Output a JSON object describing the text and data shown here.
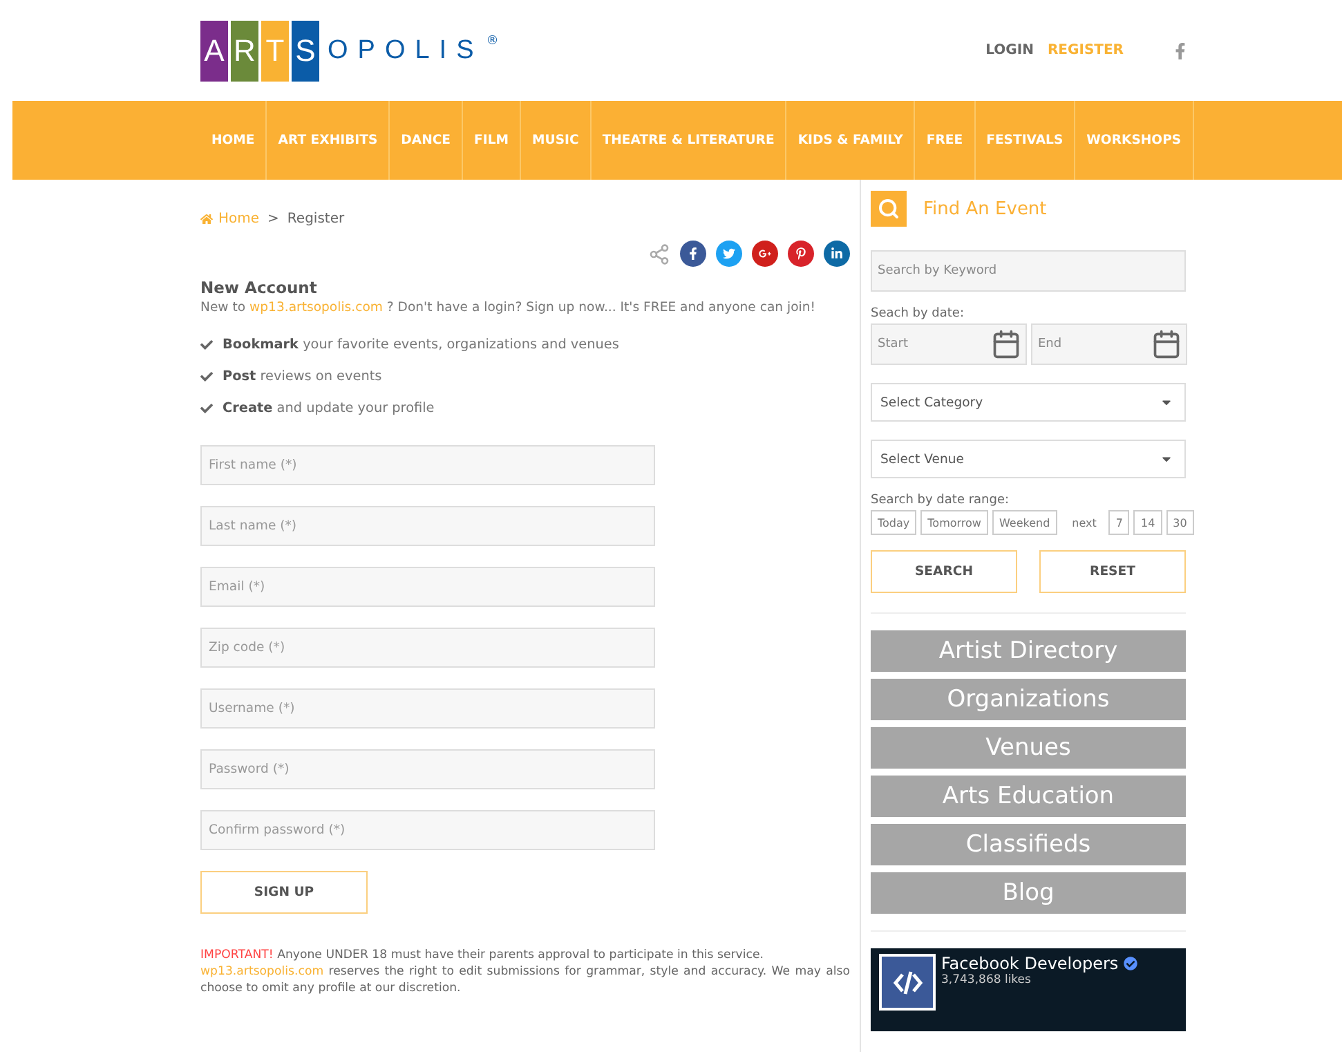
{
  "logo": {
    "tiles": [
      {
        "letter": "A",
        "color": "#7b2d8b"
      },
      {
        "letter": "R",
        "color": "#6b8a3a"
      },
      {
        "letter": "T",
        "color": "#f9b233"
      },
      {
        "letter": "S",
        "color": "#0b5ca8"
      }
    ],
    "rest": "OPOLIS",
    "mark": "®"
  },
  "header_links": [
    {
      "label": "LOGIN",
      "selected": false
    },
    {
      "label": "REGISTER",
      "selected": true
    }
  ],
  "nav": [
    "HOME",
    "ART EXHIBITS",
    "DANCE",
    "FILM",
    "MUSIC",
    "THEATRE & LITERATURE",
    "KIDS & FAMILY",
    "FREE",
    "FESTIVALS",
    "WORKSHOPS"
  ],
  "breadcrumb": {
    "home": "Home",
    "sep": ">",
    "current": "Register"
  },
  "share": [
    {
      "kind": "facebook",
      "color": "#3b5998"
    },
    {
      "kind": "twitter",
      "color": "#1da1f2"
    },
    {
      "kind": "googleplus",
      "color": "#d0201c"
    },
    {
      "kind": "pinterest",
      "color": "#d8232a"
    },
    {
      "kind": "linkedin",
      "color": "#0e6aa5"
    }
  ],
  "account": {
    "title": "New Account",
    "intro_before": "New to",
    "intro_link": "wp13.artsopolis.com",
    "intro_after": "? Don't have a login? Sign up now... It's FREE and anyone can join!",
    "benefits": [
      "**Bookmark** your favorite events, organizations and venues",
      "**Post** reviews on events",
      "**Create** and update your profile"
    ]
  },
  "form": {
    "fields": [
      {
        "placeholder": "First name (*)"
      },
      {
        "placeholder": "Last name (*)"
      },
      {
        "placeholder": "Email (*)"
      },
      {
        "placeholder": "Zip code (*)"
      },
      {
        "placeholder": "Username (*)"
      },
      {
        "placeholder": "Password (*)"
      },
      {
        "placeholder": "Confirm password (*)"
      }
    ],
    "submit": "SIGN UP"
  },
  "notice": {
    "label": "IMPORTANT!",
    "text": "Anyone UNDER 18 must have their parents approval to participate in this service.",
    "link": "wp13.artsopolis.com",
    "text2": "reserves the right to edit submissions for grammar, style and accuracy. We may also choose to omit any profile at our discretion."
  },
  "finder": {
    "title": "Find An Event",
    "keyword_placeholder": "Search by Keyword",
    "date_label": "Seach by date:",
    "start_placeholder": "Start",
    "end_placeholder": "End",
    "selects": [
      "Select Category",
      "Select Venue"
    ],
    "range_label": "Search by date range:",
    "ranges": [
      "Today",
      "Tomorrow",
      "Weekend"
    ],
    "next_label": "next",
    "next_days": [
      "7",
      "14",
      "30"
    ],
    "buttons": [
      "SEARCH",
      "RESET"
    ]
  },
  "directory": [
    "Artist Directory",
    "Organizations",
    "Venues",
    "Arts Education",
    "Classifieds",
    "Blog"
  ],
  "facebook": {
    "name": "Facebook Developers",
    "likes": "3,743,868 likes"
  }
}
